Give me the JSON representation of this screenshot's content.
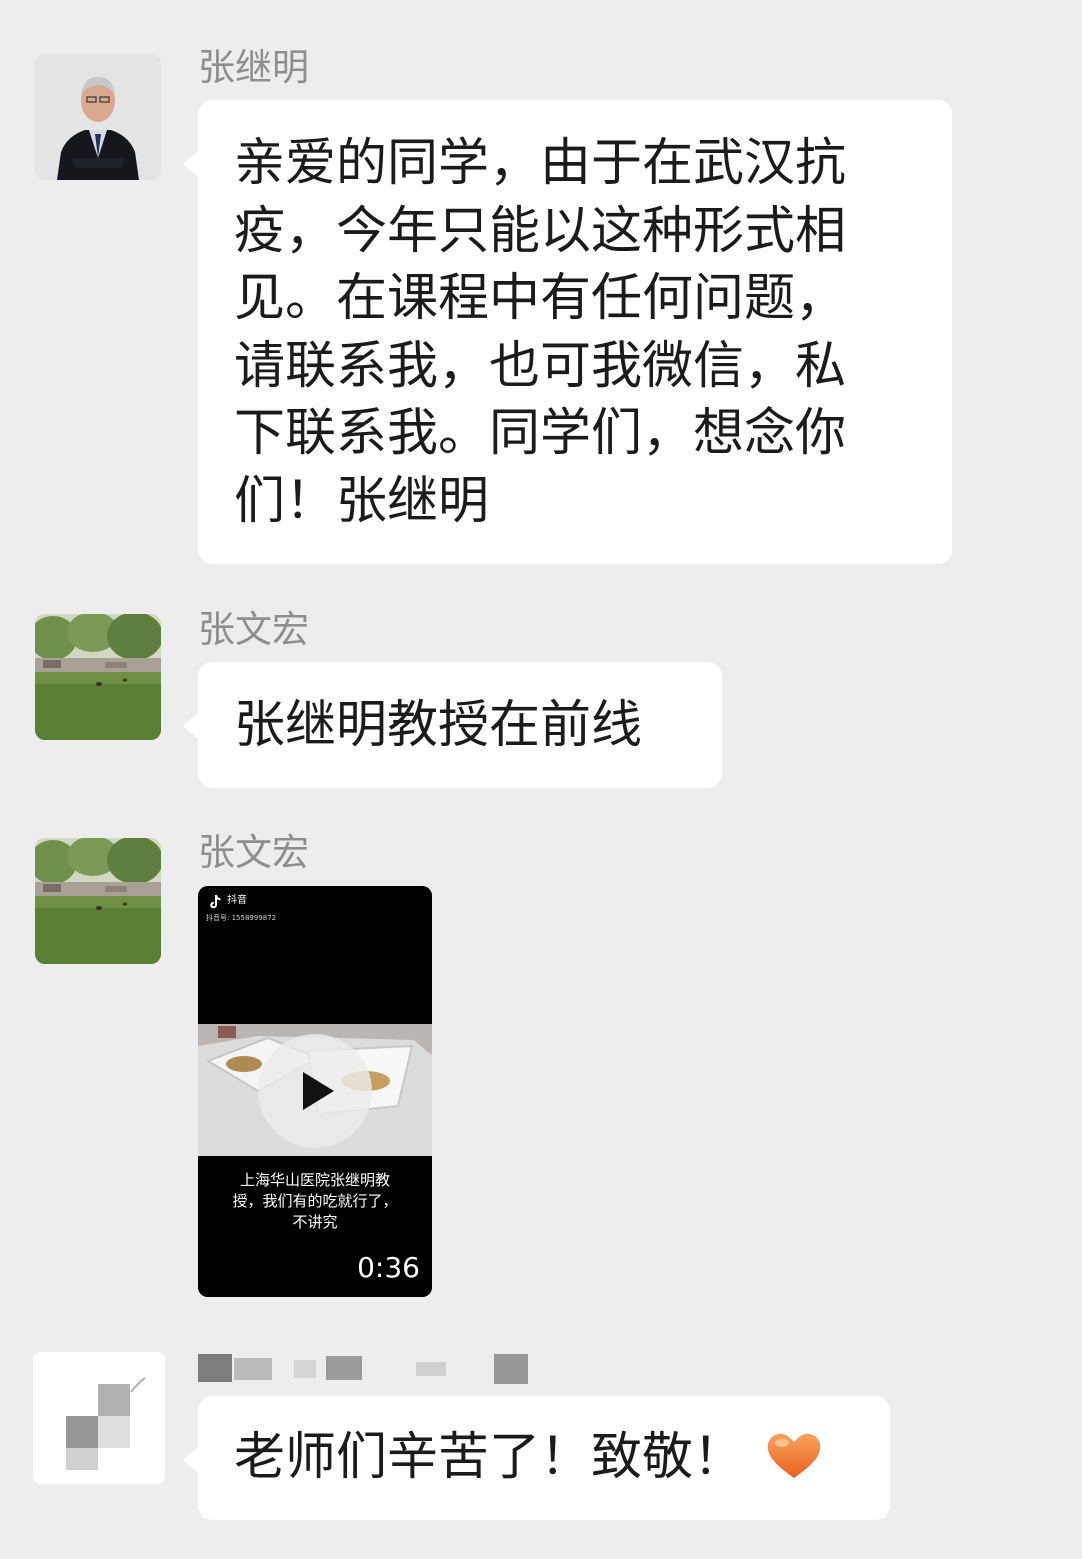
{
  "messages": [
    {
      "sender": "张继明",
      "lines": [
        "亲爱的同学，由于在武汉抗",
        "疫，今年只能以这种形式相",
        "见。在课程中有任何问题，",
        "请联系我，也可我微信，私",
        "下联系我。同学们，想念你",
        "们！张继明"
      ]
    },
    {
      "sender": "张文宏",
      "text": "张继明教授在前线"
    },
    {
      "sender": "张文宏",
      "video": {
        "app_name": "抖音",
        "account_id": "抖音号: 1558999872",
        "caption_lines": [
          "上海华山医院张继明教",
          "授，我们有的吃就行了，",
          "不讲究"
        ],
        "duration": "0:36"
      }
    },
    {
      "text": "老师们辛苦了！致敬！"
    }
  ],
  "colors": {
    "background": "#ededed",
    "bubble": "#ffffff",
    "sender_name": "#8e8e8e",
    "text": "#1b1b1b",
    "heart": "#f07a2a"
  },
  "icons": {
    "play": "play-icon",
    "tiktok": "tiktok-logo-icon",
    "heart": "orange-heart-icon"
  }
}
